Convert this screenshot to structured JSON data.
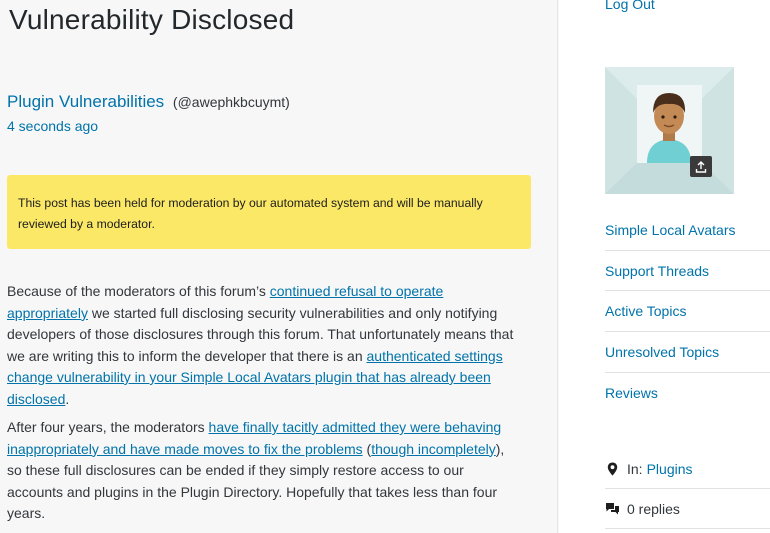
{
  "post": {
    "title": "Vulnerability Disclosed",
    "author_name": "Plugin Vulnerabilities",
    "author_handle": "(@awephkbcuymt)",
    "time": "4 seconds ago"
  },
  "notice": {
    "text": "This post has been held for moderation by our automated system and will be manually reviewed by a moderator."
  },
  "content": {
    "p1_text_1": "Because of the moderators of this forum’s ",
    "p1_link_1": "continued refusal to operate appropriately",
    "p1_text_2": " we started full disclosing security vulnerabilities and only notifying developers of those disclosures through this forum. That unfortunately means that we are writing this to inform the developer that there is an ",
    "p1_link_2": "authenticated settings change vulnerability in your Simple Local Avatars plugin that has already been disclosed",
    "p1_text_3": ".",
    "p2_text_1": "After four years, the moderators ",
    "p2_link_1": "have finally tacitly admitted they were behaving inappropriately and have made moves to fix the problems",
    "p2_text_2": " (",
    "p2_link_2": "though incompletely",
    "p2_text_3": "), so these full disclosures can be ended if they simply restore access to our accounts and plugins in the Plugin Directory. Hopefully that takes less than four years."
  },
  "sidebar": {
    "logout": "Log Out",
    "nav": [
      {
        "label": "Simple Local Avatars"
      },
      {
        "label": "Support Threads"
      },
      {
        "label": "Active Topics"
      },
      {
        "label": "Unresolved Topics"
      },
      {
        "label": "Reviews"
      }
    ],
    "meta": {
      "in_label": "In:",
      "in_link": "Plugins",
      "replies": "0 replies"
    }
  },
  "colors": {
    "link": "#0073aa",
    "notice_bg": "#fbe866",
    "avatar_bg": "#cfe3e3"
  },
  "icons": [
    "location-pin-icon",
    "speech-bubbles-icon",
    "upload-icon"
  ]
}
